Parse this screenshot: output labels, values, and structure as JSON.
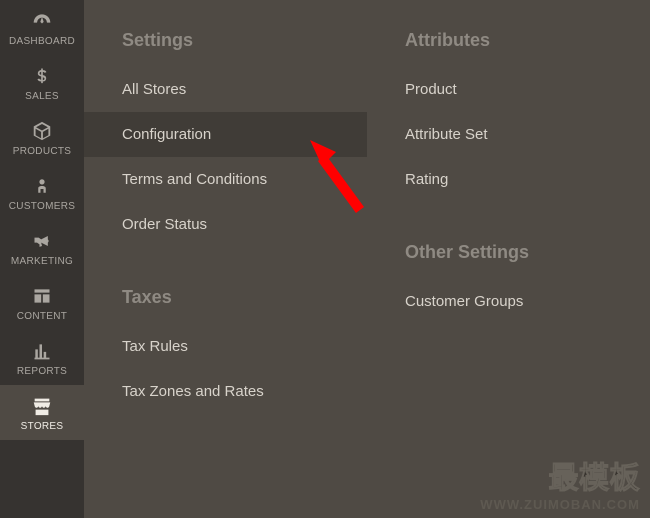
{
  "nav": [
    {
      "label": "DASHBOARD",
      "icon": "gauge"
    },
    {
      "label": "SALES",
      "icon": "dollar"
    },
    {
      "label": "PRODUCTS",
      "icon": "cube"
    },
    {
      "label": "CUSTOMERS",
      "icon": "person"
    },
    {
      "label": "MARKETING",
      "icon": "megaphone"
    },
    {
      "label": "CONTENT",
      "icon": "layout"
    },
    {
      "label": "REPORTS",
      "icon": "bars"
    },
    {
      "label": "STORES",
      "icon": "store",
      "active": true
    }
  ],
  "flyout": {
    "col1": {
      "settings_title": "Settings",
      "settings_items": [
        "All Stores",
        "Configuration",
        "Terms and Conditions",
        "Order Status"
      ],
      "settings_highlight_index": 1,
      "taxes_title": "Taxes",
      "taxes_items": [
        "Tax Rules",
        "Tax Zones and Rates"
      ]
    },
    "col2": {
      "attributes_title": "Attributes",
      "attributes_items": [
        "Product",
        "Attribute Set",
        "Rating"
      ],
      "other_title": "Other Settings",
      "other_items": [
        "Customer Groups"
      ]
    }
  },
  "watermark": {
    "cn": "最模板",
    "url": "WWW.ZUIMOBAN.COM"
  },
  "colors": {
    "arrow": "#ff0000"
  }
}
